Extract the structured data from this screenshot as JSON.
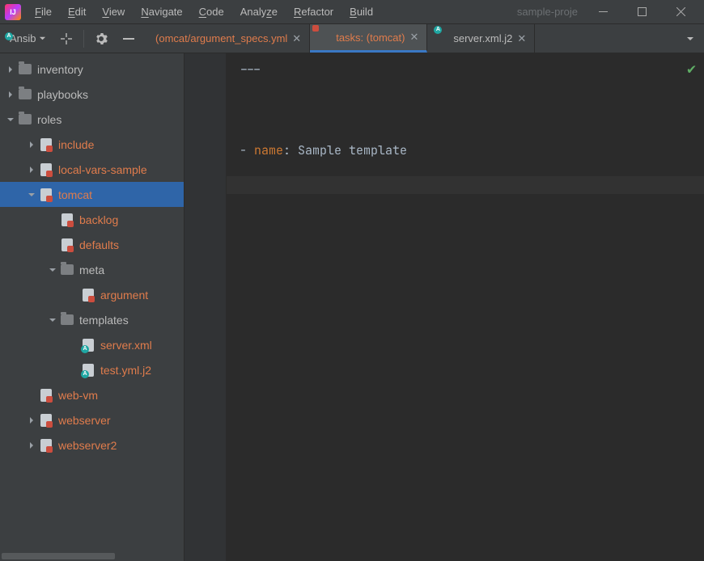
{
  "project_name": "sample-proje",
  "menu": [
    "File",
    "Edit",
    "View",
    "Navigate",
    "Code",
    "Analyze",
    "Refactor",
    "Build"
  ],
  "breadcrumb_label": "Ansible",
  "tabs": [
    {
      "label": "omcat/argument_specs.yml)",
      "icon": "ansible-file",
      "active": false,
      "color": "orange"
    },
    {
      "label": "tasks: (tomcat)",
      "icon": "ansible-file",
      "active": true,
      "color": "orange"
    },
    {
      "label": "server.xml.j2",
      "icon": "j2-file",
      "active": false,
      "color": "gray"
    }
  ],
  "tree": {
    "inventory": "inventory",
    "playbooks": "playbooks",
    "roles": "roles",
    "include": "include",
    "localvars": "local-vars-sample",
    "tomcat": "tomcat",
    "backlog": "backlog",
    "defaults": "defaults",
    "meta": "meta",
    "argument": "argument",
    "templates": "templates",
    "serverxml": "server.xml",
    "testyml": "test.yml.j2",
    "webvm": "web-vm",
    "webserver": "webserver",
    "webserver2": "webserver2"
  },
  "editor": {
    "frontmatter": "---",
    "name_key": "name",
    "name_val": "Sample template"
  }
}
